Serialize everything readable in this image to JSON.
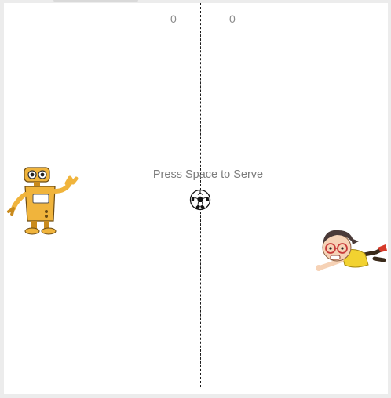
{
  "scoreboard": {
    "left_score": "0",
    "right_score": "0"
  },
  "message": "Press Space to Serve",
  "icons": {
    "left_player": "robot-icon",
    "right_player": "cartoon-boy-icon",
    "ball": "soccer-ball-icon"
  },
  "colors": {
    "background": "#ffffff",
    "center_line": "#1a1a1a",
    "score_text": "#8a8a8a",
    "robot_body": "#f0b43c"
  }
}
